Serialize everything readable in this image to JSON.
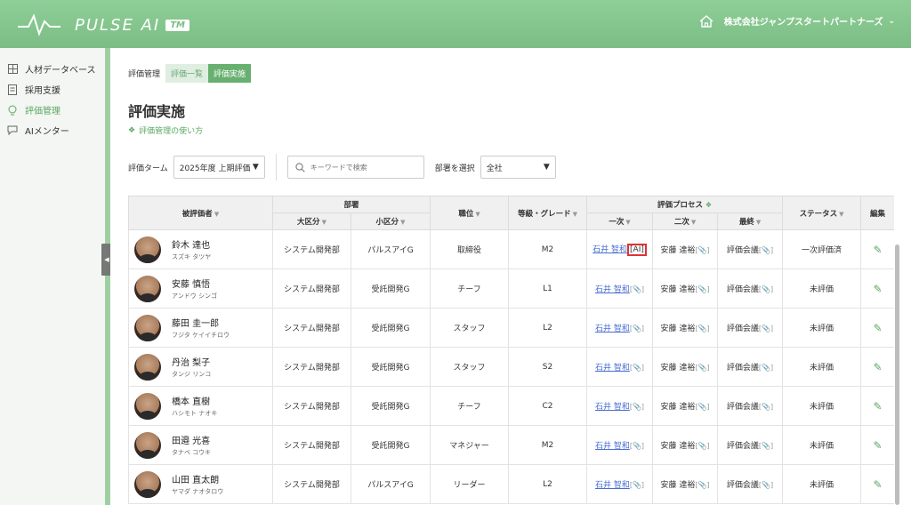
{
  "header": {
    "logo_text": "PULSE AI",
    "logo_tm": "TM",
    "company": "株式会社ジャンプスタートパートナーズ"
  },
  "sidebar": {
    "items": [
      {
        "label": "人材データベース",
        "icon": "database-icon"
      },
      {
        "label": "採用支援",
        "icon": "document-icon"
      },
      {
        "label": "評価管理",
        "icon": "lightbulb-icon",
        "active": true
      },
      {
        "label": "AIメンター",
        "icon": "chat-icon"
      }
    ]
  },
  "breadcrumb": {
    "label": "評価管理",
    "tabs": [
      "評価一覧",
      "評価実施"
    ]
  },
  "page": {
    "title": "評価実施",
    "howto": "評価管理の使い方"
  },
  "filters": {
    "term_label": "評価ターム",
    "term_value": "2025年度 上期評価",
    "search_placeholder": "キーワードで検索",
    "dept_label": "部署を選択",
    "dept_value": "全社"
  },
  "table": {
    "headers": {
      "evaluee": "被評価者",
      "department": "部署",
      "dept_major": "大区分",
      "dept_minor": "小区分",
      "position": "職位",
      "grade": "等級・グレード",
      "process": "評価プロセス",
      "first": "一次",
      "second": "二次",
      "final": "最終",
      "status": "ステータス",
      "edit": "編集"
    },
    "rows": [
      {
        "name": "鈴木 達也",
        "kana": "スズキ タツヤ",
        "major": "システム開発部",
        "minor": "パルスアイG",
        "position": "取締役",
        "grade": "M2",
        "first": "石井 智和",
        "first_tag": "[AI]",
        "second": "安藤 達裕",
        "final": "評価会議",
        "status": "一次評価済"
      },
      {
        "name": "安藤 慎悟",
        "kana": "アンドウ シンゴ",
        "major": "システム開発部",
        "minor": "受託開発G",
        "position": "チーフ",
        "grade": "L1",
        "first": "石井 智和",
        "first_tag": "",
        "second": "安藤 達裕",
        "final": "評価会議",
        "status": "未評価"
      },
      {
        "name": "藤田 圭一郎",
        "kana": "フジタ ケイイチロウ",
        "major": "システム開発部",
        "minor": "受託開発G",
        "position": "スタッフ",
        "grade": "L2",
        "first": "石井 智和",
        "first_tag": "",
        "second": "安藤 達裕",
        "final": "評価会議",
        "status": "未評価"
      },
      {
        "name": "丹治 梨子",
        "kana": "タンジ リンコ",
        "major": "システム開発部",
        "minor": "受託開発G",
        "position": "スタッフ",
        "grade": "S2",
        "first": "石井 智和",
        "first_tag": "",
        "second": "安藤 達裕",
        "final": "評価会議",
        "status": "未評価"
      },
      {
        "name": "橋本 直樹",
        "kana": "ハシモト ナオキ",
        "major": "システム開発部",
        "minor": "受託開発G",
        "position": "チーフ",
        "grade": "C2",
        "first": "石井 智和",
        "first_tag": "",
        "second": "安藤 達裕",
        "final": "評価会議",
        "status": "未評価"
      },
      {
        "name": "田邉 光喜",
        "kana": "タナベ コウキ",
        "major": "システム開発部",
        "minor": "受託開発G",
        "position": "マネジャー",
        "grade": "M2",
        "first": "石井 智和",
        "first_tag": "",
        "second": "安藤 達裕",
        "final": "評価会議",
        "status": "未評価"
      },
      {
        "name": "山田 直太朗",
        "kana": "ヤマダ ナオタロウ",
        "major": "システム開発部",
        "minor": "パルスアイG",
        "position": "リーダー",
        "grade": "L2",
        "first": "石井 智和",
        "first_tag": "",
        "second": "安藤 達裕",
        "final": "評価会議",
        "status": "未評価"
      }
    ]
  },
  "colors": {
    "accent": "#67b06f",
    "header": "#7bbd85",
    "link": "#4a6fd0",
    "highlight": "#dd3333"
  }
}
